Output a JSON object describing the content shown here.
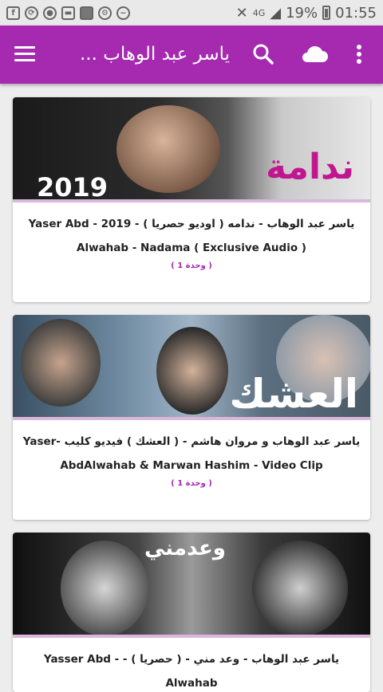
{
  "status_bar": {
    "signal_label": "4G",
    "battery_text": "19%",
    "time": "01:55"
  },
  "app_bar": {
    "title": "ياسر عبد الوهاب ..."
  },
  "videos": [
    {
      "title": "ياسر عبد الوهاب - ندامه ( اوديو حصريا ) - 2019 - Yaser Abd Alwahab - Nadama ( Exclusive Audio )",
      "count": "( 1 وحدة )",
      "overlay_text": "ندامة",
      "overlay_year": "2019"
    },
    {
      "title": "ياسر عبد الوهاب و مروان هاشم - ( العشك ) فيديو كليب -Yaser AbdAlwahab & Marwan Hashim - Video Clip",
      "count": "( 1 وحدة )",
      "overlay_text": "العشك"
    },
    {
      "title": "ياسر عبد الوهاب - وعد مني - ( حصريا ) - - Yasser Abd Alwahab",
      "count": "",
      "overlay_text": "وعدمني"
    }
  ],
  "colors": {
    "primary": "#a52ab0",
    "status_bar": "#e9e9e9",
    "background": "#ededed"
  }
}
